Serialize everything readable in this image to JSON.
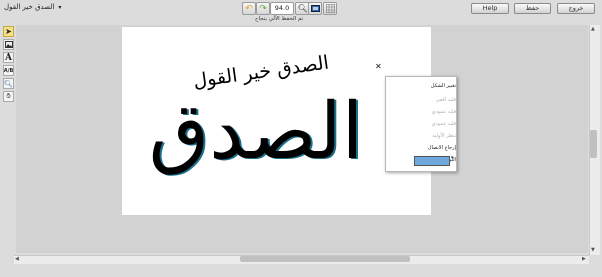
{
  "header": {
    "title": "الصدق خير القول",
    "status_text": "تم الحفظ الآلي بنجاح",
    "zoom_value": "94.0"
  },
  "top_buttons": {
    "exit": "خروج",
    "save": "حفظ",
    "help": "Help"
  },
  "artwork": {
    "small_text": "الصدق خير القول",
    "large_text": "الصدق"
  },
  "context_menu": {
    "items": [
      {
        "label": "تغيير الشكل",
        "enabled": true
      },
      {
        "label": "قلبه أفقي",
        "enabled": false
      },
      {
        "label": "قلبه عمودي",
        "enabled": false
      },
      {
        "label": "قلبه عمودي",
        "enabled": false
      },
      {
        "label": "تنظر الأوليه",
        "enabled": false
      },
      {
        "label": "إرجاع الاتصال",
        "enabled": true
      },
      {
        "label": "اللون",
        "enabled": true
      }
    ],
    "color": "#6fa8dc"
  },
  "icons": {
    "undo": "undo-icon",
    "redo": "redo-icon",
    "zoom": "magnifier-icon",
    "image": "image-icon",
    "grid": "grid-icon",
    "tools": [
      "pointer-icon",
      "image-tool-icon",
      "text-tool-icon",
      "text-format-icon",
      "zoom-tool-icon",
      "hand-icon"
    ]
  }
}
